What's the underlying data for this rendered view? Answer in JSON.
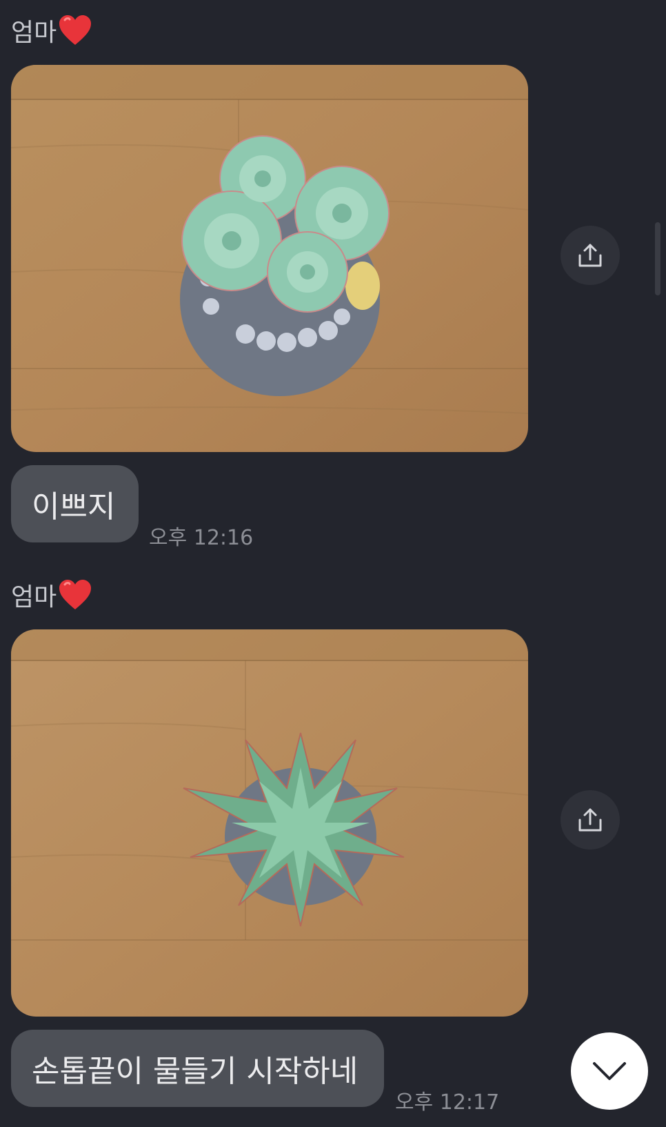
{
  "messages": [
    {
      "sender": "엄마",
      "heart_icon": "red-heart-emoji",
      "photo_subject": "succulent-echeveria-round",
      "share_icon": "share-upload-icon",
      "text": "이쁘지",
      "time": "오후 12:16"
    },
    {
      "sender": "엄마",
      "heart_icon": "red-heart-emoji",
      "photo_subject": "succulent-pointed-rosette",
      "share_icon": "share-upload-icon",
      "text": "손톱끝이 물들기 시작하네",
      "time": "오후 12:17"
    }
  ],
  "scroll_down_icon": "chevron-down-icon",
  "colors": {
    "background": "#23252d",
    "bubble": "#4d5057",
    "bubble_text": "#ececee",
    "time_text": "#8d8f96",
    "sender_text": "#c7c9cf",
    "heart": "#e8343a",
    "wood": "#b58a5c"
  }
}
